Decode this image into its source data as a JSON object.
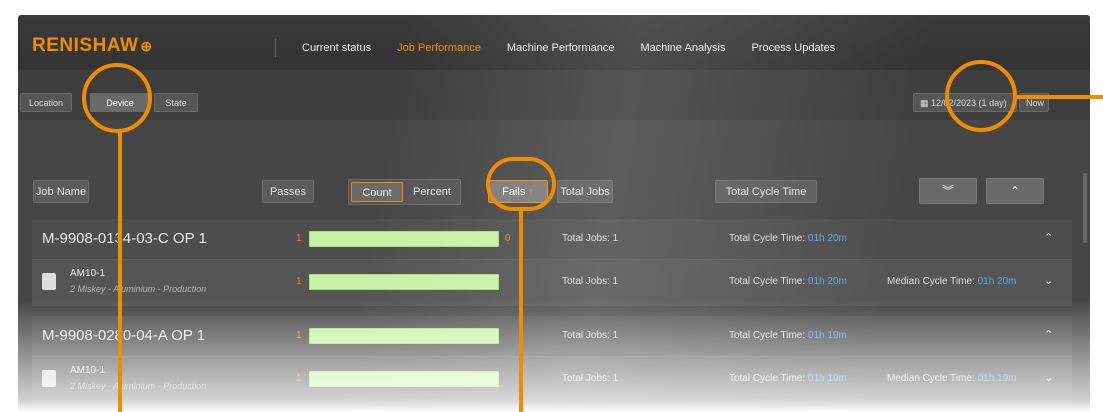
{
  "brand": {
    "name": "RENISHAW",
    "mark": "⊕"
  },
  "nav": {
    "items": [
      {
        "label": "Current status",
        "active": false
      },
      {
        "label": "Job Performance",
        "active": true
      },
      {
        "label": "Machine Performance",
        "active": false
      },
      {
        "label": "Machine Analysis",
        "active": false
      },
      {
        "label": "Process Updates",
        "active": false
      }
    ]
  },
  "filters": {
    "location": "Location",
    "device": "Device",
    "state": "State",
    "date": "12/02/2023 (1 day)",
    "now": "Now"
  },
  "headers": {
    "job_name": "Job Name",
    "passes": "Passes",
    "count": "Count",
    "percent": "Percent",
    "fails": "Fails",
    "total_jobs": "Total Jobs",
    "total_cycle_time": "Total Cycle Time",
    "expand_icon": "chevron-double-down",
    "collapse_icon": "chevron-up"
  },
  "rows": [
    {
      "job": "M-9908-0134-03-C OP 1",
      "passes": "1",
      "fails": "0",
      "total_jobs": "Total Jobs: 1",
      "total_cycle_label": "Total Cycle Time:",
      "total_cycle_time": "01h 20m",
      "device": {
        "name": "AM10-1",
        "sub": "2 Miskey - Aluminium - Production",
        "passes": "1",
        "total_jobs": "Total Jobs: 1",
        "total_cycle_label": "Total Cycle Time:",
        "total_cycle_time": "01h 20m",
        "median_label": "Median Cycle Time:",
        "median_time": "01h 20m"
      }
    },
    {
      "job": "M-9908-0280-04-A OP 1",
      "passes": "1",
      "fails": "",
      "total_jobs": "Total Jobs: 1",
      "total_cycle_label": "Total Cycle Time:",
      "total_cycle_time": "01h 19m",
      "device": {
        "name": "AM10-1",
        "sub": "2 Miskey - Aluminium - Production",
        "passes": "1",
        "total_jobs": "Total Jobs: 1",
        "total_cycle_label": "Total Cycle Time:",
        "total_cycle_time": "01h 19m",
        "median_label": "Median Cycle Time:",
        "median_time": "01h 19m"
      }
    }
  ],
  "accent": "#f08c00"
}
